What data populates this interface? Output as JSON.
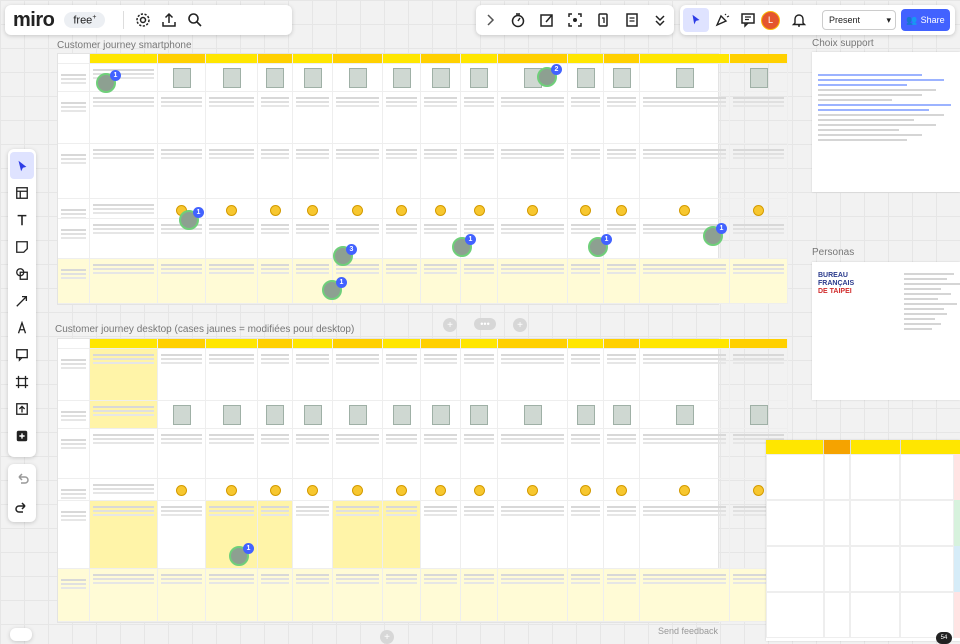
{
  "app": {
    "logo": "miro",
    "plan_badge": "free",
    "plan_sup": "+"
  },
  "toolbar_right": {
    "present_label": "Present",
    "share_label": "Share",
    "avatar_initial": "L"
  },
  "frames": {
    "smartphone_title": "Customer journey smartphone",
    "desktop_title": "Customer journey desktop (cases jaunes = modifiées pour desktop)",
    "choix_support_title": "Choix support",
    "personas_title": "Personas",
    "personas_logo_line1": "BUREAU",
    "personas_logo_line2": "FRANÇAIS",
    "personas_logo_line3": "DE TAIPEI"
  },
  "badges": {
    "b1": "1",
    "b2": "2",
    "b3": "1",
    "b4": "3",
    "b5": "1",
    "b6": "1",
    "b7": "1",
    "b8": "1",
    "b9": "1"
  },
  "footer": {
    "send_feedback": "Send feedback",
    "chat_count": "54"
  }
}
